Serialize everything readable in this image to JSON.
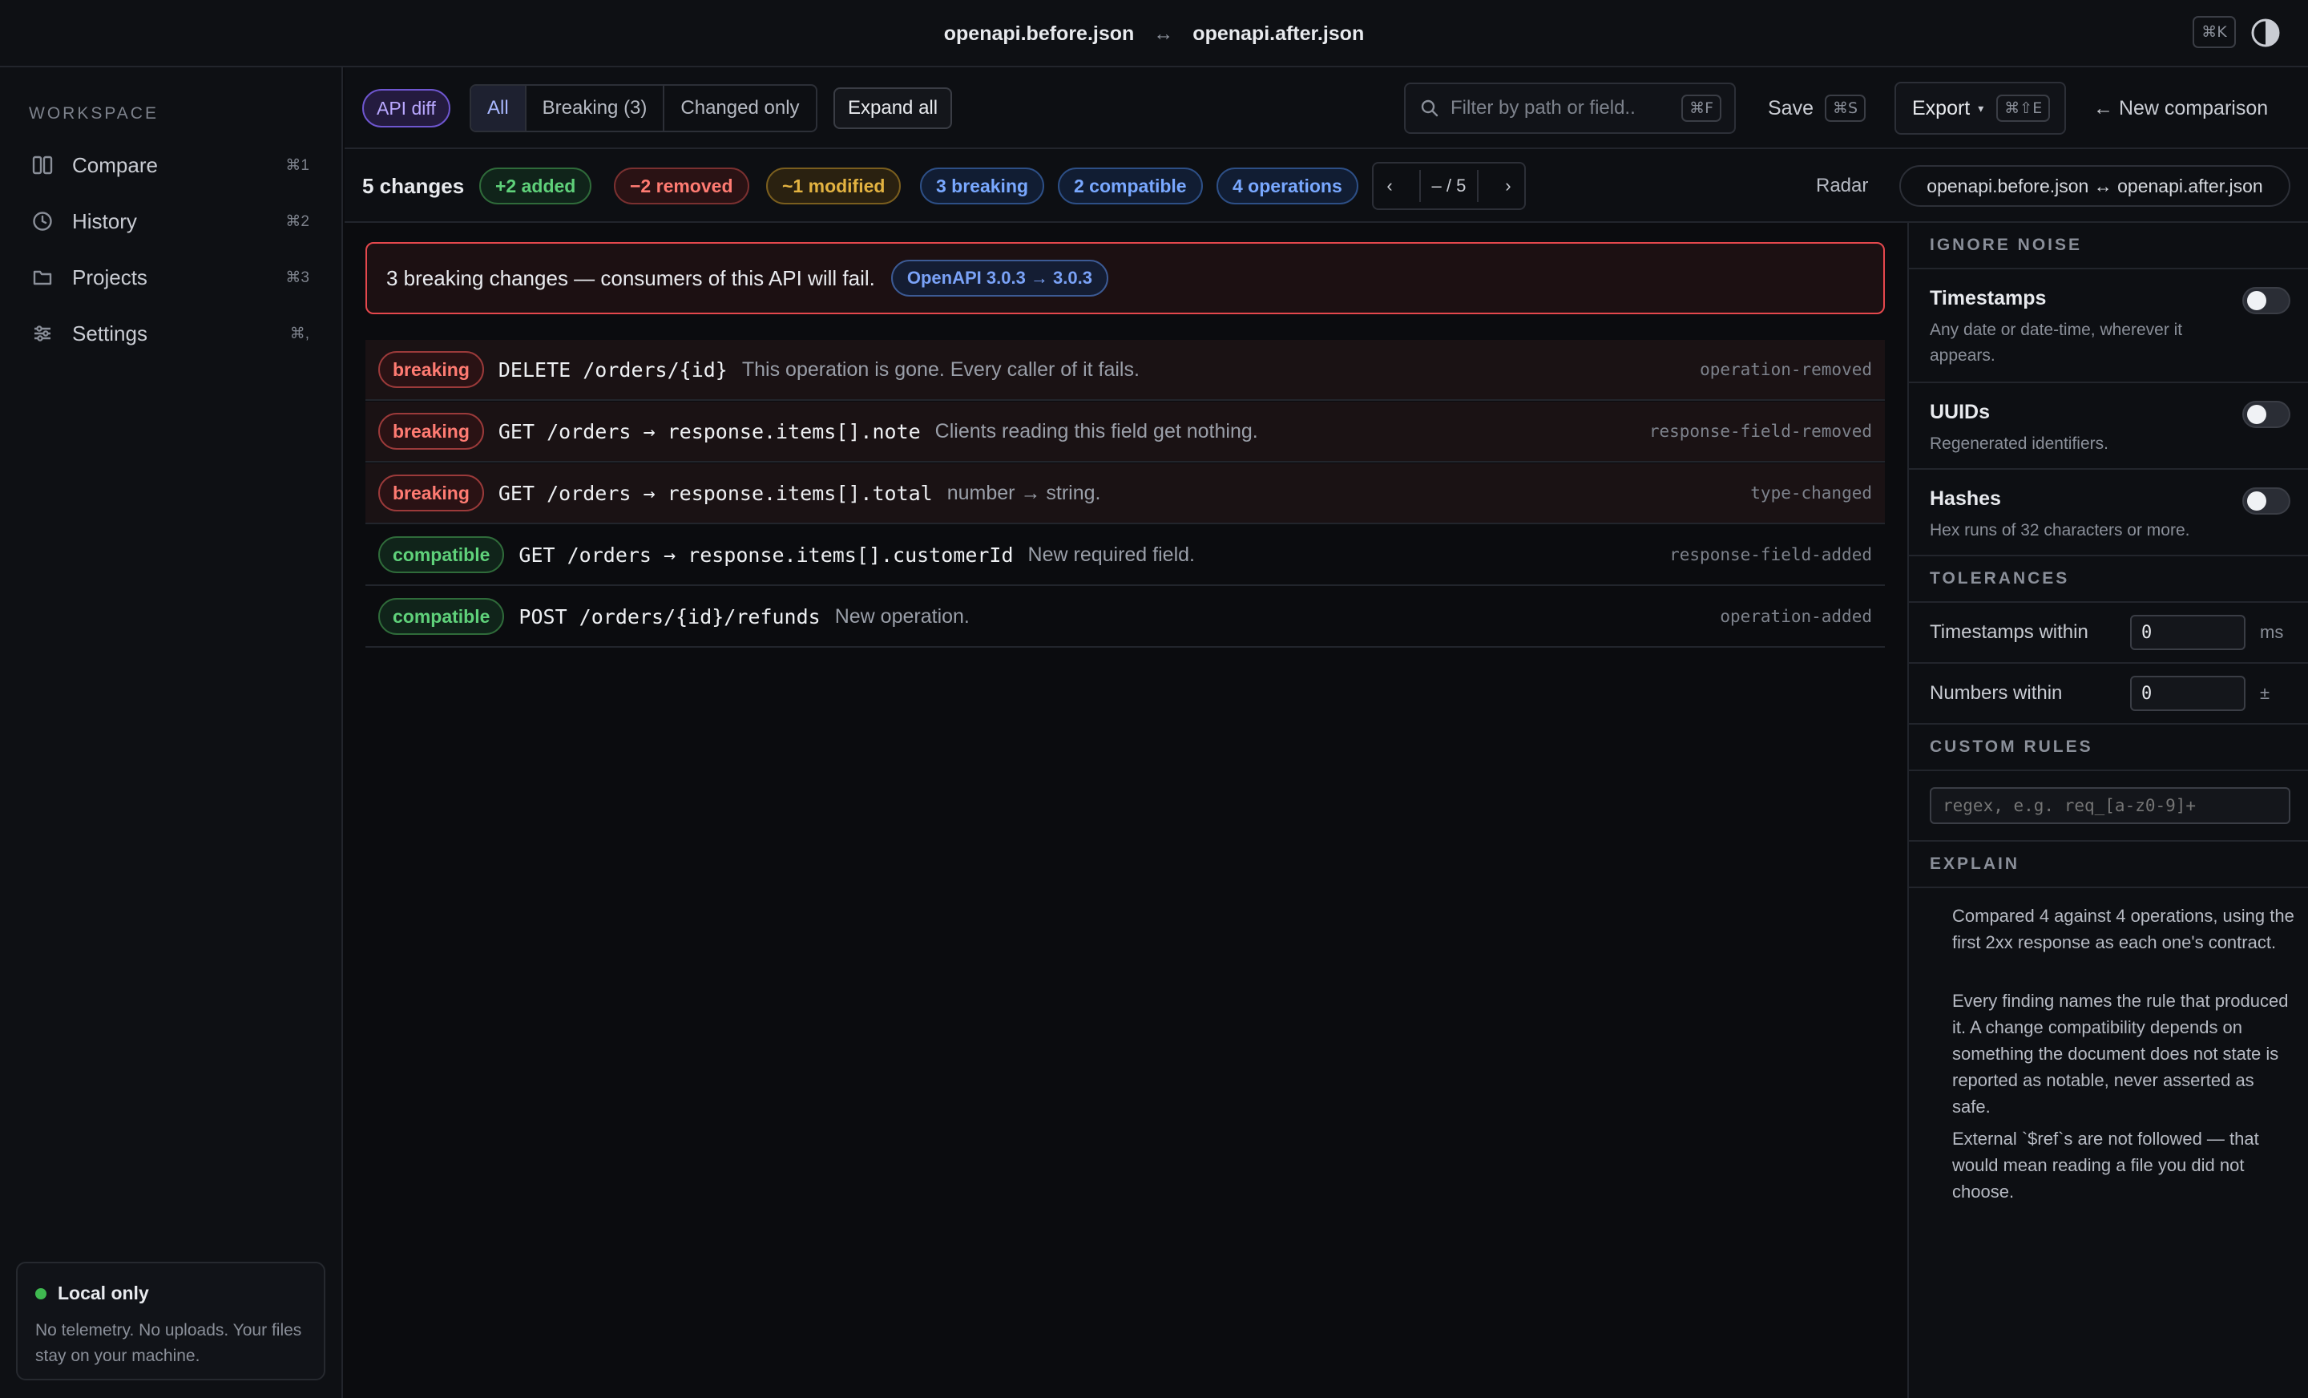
{
  "titlebar": {
    "before_file": "openapi.before.json",
    "arrow": "↔",
    "after_file": "openapi.after.json",
    "shortcut": "⌘K"
  },
  "sidebar": {
    "heading": "WORKSPACE",
    "items": [
      {
        "label": "Compare",
        "shortcut": "⌘1",
        "icon": "columns-icon"
      },
      {
        "label": "History",
        "shortcut": "⌘2",
        "icon": "clock-icon"
      },
      {
        "label": "Projects",
        "shortcut": "⌘3",
        "icon": "folder-icon"
      },
      {
        "label": "Settings",
        "shortcut": "⌘,",
        "icon": "sliders-icon"
      }
    ],
    "local": {
      "title": "Local only",
      "description": "No telemetry. No uploads. Your files stay on your machine."
    }
  },
  "toolbar": {
    "mode_pill": "API diff",
    "filters": [
      "All",
      "Breaking (3)",
      "Changed only"
    ],
    "expand_all": "Expand all",
    "search_placeholder": "Filter by path or field..",
    "search_shortcut": "⌘F",
    "save_label": "Save",
    "save_shortcut": "⌘S",
    "export_label": "Export",
    "export_shortcut": "⌘⇧E",
    "new_comparison": "← New comparison"
  },
  "summary": {
    "count": "5 changes",
    "added": "+2 added",
    "removed": "−2 removed",
    "modified": "~1 modified",
    "breaking": "3 breaking",
    "compatible": "2 compatible",
    "operations": "4 operations",
    "pager": {
      "prev": "‹",
      "current": "–",
      "sep": "/",
      "total": "5",
      "next": "›"
    },
    "radar": "Radar",
    "pair": "openapi.before.json ↔ openapi.after.json"
  },
  "banner": {
    "message": "3 breaking changes — consumers of this API will fail.",
    "version": "OpenAPI 3.0.3 → 3.0.3"
  },
  "changes": [
    {
      "kind": "breaking",
      "path": "DELETE /orders/{id}",
      "description": "This operation is gone. Every caller of it fails.",
      "rule": "operation-removed"
    },
    {
      "kind": "breaking",
      "path": "GET /orders → response.items[].note",
      "description": "Clients reading this field get nothing.",
      "rule": "response-field-removed"
    },
    {
      "kind": "breaking",
      "path": "GET /orders → response.items[].total",
      "description": "number → string.",
      "rule": "type-changed"
    },
    {
      "kind": "compatible",
      "path": "GET /orders → response.items[].customerId",
      "description": "New required field.",
      "rule": "response-field-added"
    },
    {
      "kind": "compatible",
      "path": "POST /orders/{id}/refunds",
      "description": "New operation.",
      "rule": "operation-added"
    }
  ],
  "panel": {
    "ignore_noise": "IGNORE NOISE",
    "toggles": [
      {
        "name": "Timestamps",
        "description": "Any date or date-time, wherever it appears.",
        "on": false
      },
      {
        "name": "UUIDs",
        "description": "Regenerated identifiers.",
        "on": false
      },
      {
        "name": "Hashes",
        "description": "Hex runs of 32 characters or more.",
        "on": false
      }
    ],
    "tolerances": "TOLERANCES",
    "timestamps_within": "Timestamps within",
    "timestamps_value": "0",
    "timestamps_unit": "ms",
    "numbers_within": "Numbers within",
    "numbers_value": "0",
    "numbers_unit": "±",
    "custom_rules": "CUSTOM RULES",
    "regex_placeholder": "regex, e.g. req_[a-z0-9]+",
    "explain": "EXPLAIN",
    "explain_paragraphs": [
      "Compared 4 against 4 operations, using the first 2xx response as each one's contract.",
      "Every finding names the rule that produced it. A change compatibility depends on something the document does not state is reported as notable, never asserted as safe.",
      "External `$ref`s are not followed — that would mean reading a file you did not choose."
    ]
  },
  "colors": {
    "accent": "#6e56cf",
    "breaking": "#ff7b72",
    "compatible": "#5fd17a",
    "modified": "#e3b341",
    "info": "#79a8ff",
    "banner_border": "#e5484d"
  }
}
